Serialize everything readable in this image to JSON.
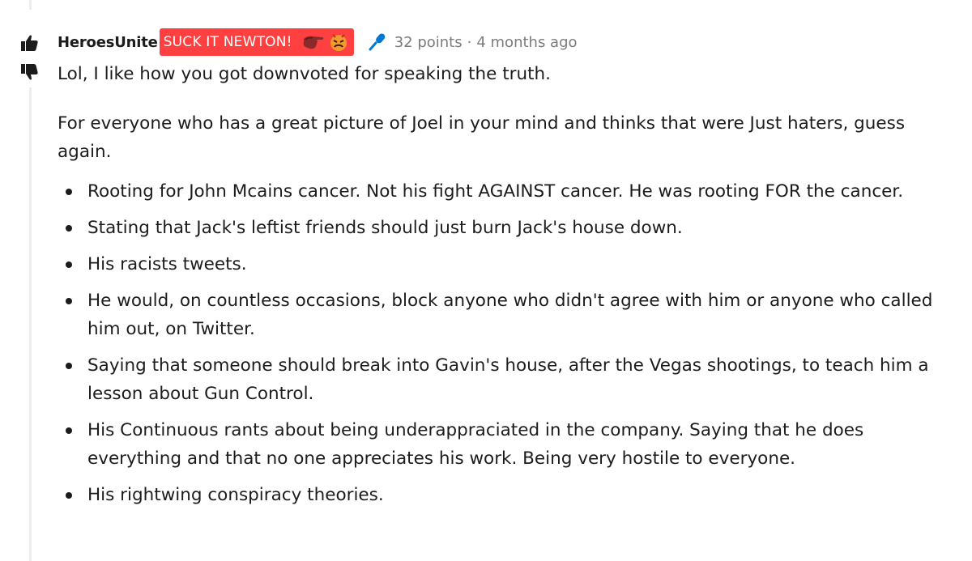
{
  "comment": {
    "author": "HeroesUnite",
    "flair": {
      "text": "SUCK IT NEWTON!",
      "background": "#ff4040",
      "emojis": [
        "pointing-hand-emoji",
        "angry-face-emoji"
      ]
    },
    "award_icon": "microphone-icon",
    "points": "32 points",
    "separator": "·",
    "age": "4 months ago",
    "paragraphs": [
      "Lol, I like how you got downvoted for speaking the truth.",
      "For everyone who has a great picture of Joel in your mind and thinks that were Just haters, guess again."
    ],
    "bullets": [
      "Rooting for John Mcains cancer. Not his fight AGAINST cancer. He was rooting FOR the cancer.",
      "Stating that Jack's leftist friends should just burn Jack's house down.",
      "His racists tweets.",
      "He would, on countless occasions, block anyone who didn't agree with him or anyone who called him out, on Twitter.",
      "Saying that someone should break into Gavin's house, after the Vegas shootings, to teach him a lesson about Gun Control.",
      "His Continuous rants about being underappraciated in the company. Saying that he does everything and that no one appreciates his work. Being very hostile to everyone.",
      "His rightwing conspiracy theories."
    ]
  },
  "votes": {
    "upvote_icon": "thumbs-up-icon",
    "downvote_icon": "thumbs-down-icon"
  },
  "colors": {
    "text": "#1c1c1c",
    "meta": "#7c7c7c",
    "flair": "#ff4040",
    "thread_line": "#ededed",
    "mic": "#0079d3"
  }
}
